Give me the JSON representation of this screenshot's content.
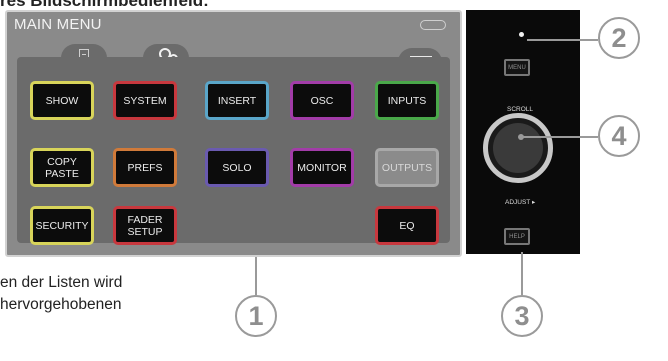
{
  "top_caption": "res Bildschirmbedienfeld:",
  "screen": {
    "title": "MAIN MENU",
    "buttons": [
      {
        "label": "SHOW",
        "border": "#d8d45a"
      },
      {
        "label": "SYSTEM",
        "border": "#c8383e"
      },
      {
        "label": "INSERT",
        "border": "#5aa6c9"
      },
      {
        "label": "OSC",
        "border": "#a23ca8"
      },
      {
        "label": "INPUTS",
        "border": "#4aa84a"
      },
      {
        "label": "COPY\nPASTE",
        "border": "#d8d45a"
      },
      {
        "label": "PREFS",
        "border": "#d07a3a"
      },
      {
        "label": "SOLO",
        "border": "#6a5ab0"
      },
      {
        "label": "MONITOR",
        "border": "#a23ca8"
      },
      {
        "label": "OUTPUTS",
        "border": "#a8a8a8",
        "dim": true
      },
      {
        "label": "SECURITY",
        "border": "#d8d45a"
      },
      {
        "label": "FADER\nSETUP",
        "border": "#c8383e"
      },
      {
        "label": "EQ",
        "border": "#c8383e"
      }
    ]
  },
  "hardware": {
    "menu_label": "MENU",
    "scroll_label": "SCROLL",
    "adjust_label": "ADJUST ▸",
    "help_label": "HELP"
  },
  "callouts": {
    "c1": "1",
    "c2": "2",
    "c3": "3",
    "c4": "4"
  },
  "body_text": {
    "line1": "en der Listen wird",
    "line2": "hervorgehobenen"
  },
  "icons": [
    "file-icon",
    "gears-icon",
    "wave-icon"
  ]
}
